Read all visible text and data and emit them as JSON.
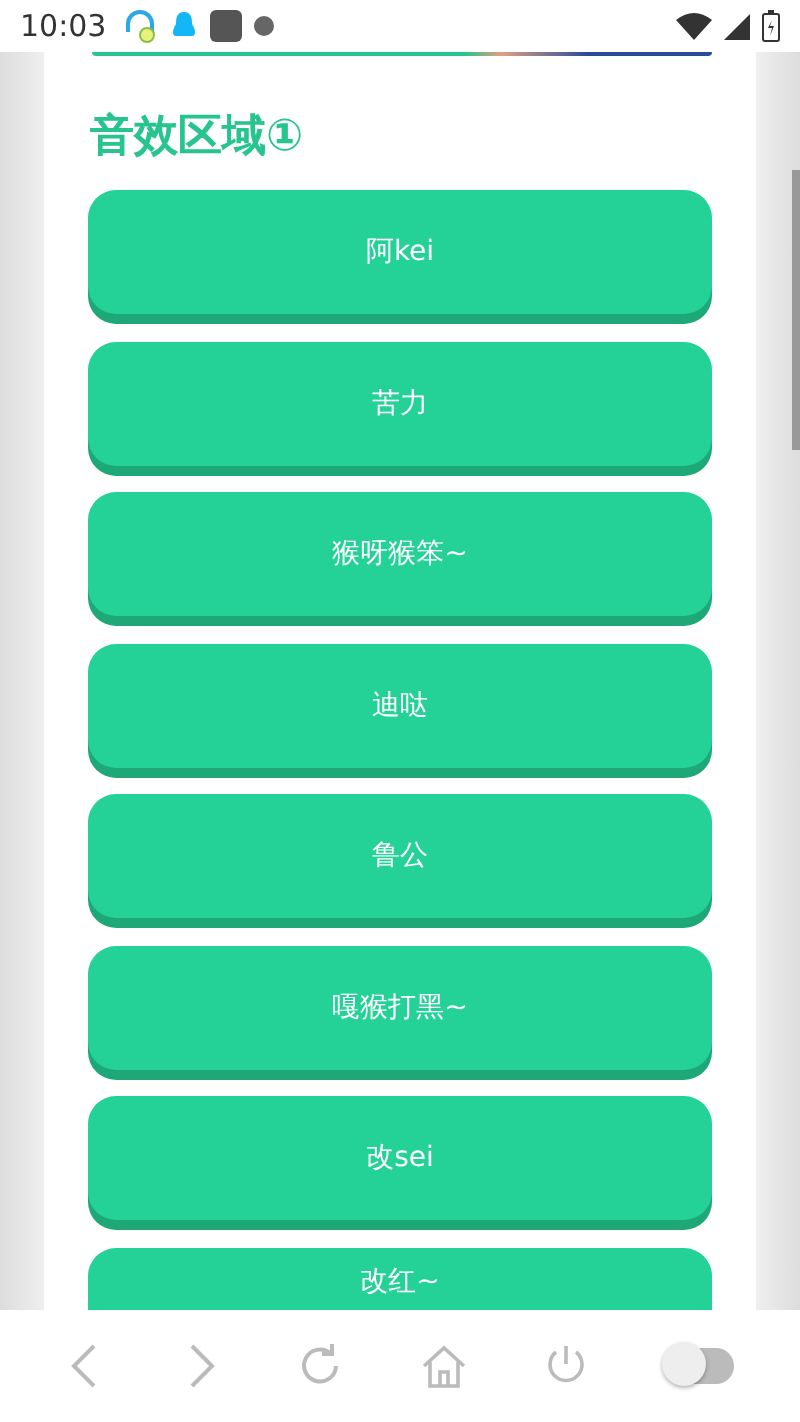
{
  "status_bar": {
    "time": "10:03"
  },
  "section": {
    "title": "音效区域①"
  },
  "sound_buttons": [
    {
      "label": "阿kei"
    },
    {
      "label": "苦力"
    },
    {
      "label": "猴呀猴笨~"
    },
    {
      "label": "迪哒"
    },
    {
      "label": "鲁公"
    },
    {
      "label": "嘎猴打黑~"
    },
    {
      "label": "改sei"
    },
    {
      "label": "改红~"
    }
  ],
  "toolbar": {
    "toggle": {
      "on": false
    }
  }
}
